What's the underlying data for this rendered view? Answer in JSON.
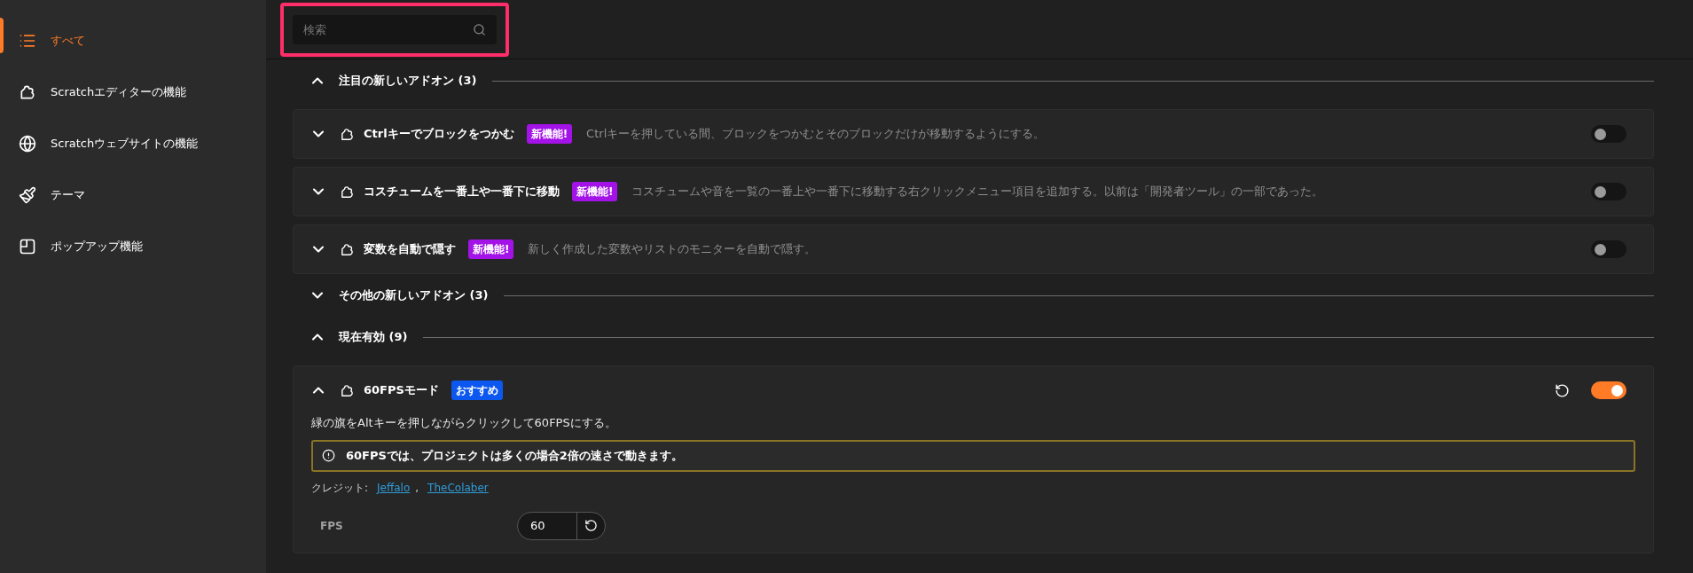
{
  "sidebar": {
    "items": [
      {
        "kind": "all",
        "label": "すべて",
        "selected": true
      },
      {
        "kind": "editor",
        "label": "Scratchエディターの機能",
        "selected": false
      },
      {
        "kind": "website",
        "label": "Scratchウェブサイトの機能",
        "selected": false
      },
      {
        "kind": "theme",
        "label": "テーマ",
        "selected": false
      },
      {
        "kind": "popup",
        "label": "ポップアップ機能",
        "selected": false
      }
    ]
  },
  "search": {
    "placeholder": "検索",
    "highlighted": true
  },
  "sections": [
    {
      "title": "注目の新しいアドオン (3)",
      "expanded": true,
      "addons": [
        {
          "name": "Ctrlキーでブロックをつかむ",
          "badge": {
            "kind": "new",
            "text": "新機能!"
          },
          "description": "Ctrlキーを押している間、ブロックをつかむとそのブロックだけが移動するようにする。",
          "expanded": false,
          "enabled": false
        },
        {
          "name": "コスチュームを一番上や一番下に移動",
          "badge": {
            "kind": "new",
            "text": "新機能!"
          },
          "description": "コスチュームや音を一覧の一番上や一番下に移動する右クリックメニュー項目を追加する。以前は「開発者ツール」の一部であった。",
          "expanded": false,
          "enabled": false
        },
        {
          "name": "変数を自動で隠す",
          "badge": {
            "kind": "new",
            "text": "新機能!"
          },
          "description": "新しく作成した変数やリストのモニターを自動で隠す。",
          "expanded": false,
          "enabled": false
        }
      ]
    },
    {
      "title": "その他の新しいアドオン (3)",
      "expanded": false
    },
    {
      "title": "現在有効 (9)",
      "expanded": true,
      "addons": [
        {
          "name": "60FPSモード",
          "badge": {
            "kind": "recommended",
            "text": "おすすめ"
          },
          "description": "緑の旗をAltキーを押しながらクリックして60FPSにする。",
          "expanded": true,
          "enabled": true,
          "notice": "60FPSでは、プロジェクトは多くの場合2倍の速さで動きます。",
          "credits_label": "クレジット:",
          "credits": [
            {
              "name": "Jeffalo",
              "separator": ","
            },
            {
              "name": "TheColaber"
            }
          ],
          "settings": [
            {
              "label": "FPS",
              "value": "60"
            }
          ]
        }
      ]
    }
  ]
}
